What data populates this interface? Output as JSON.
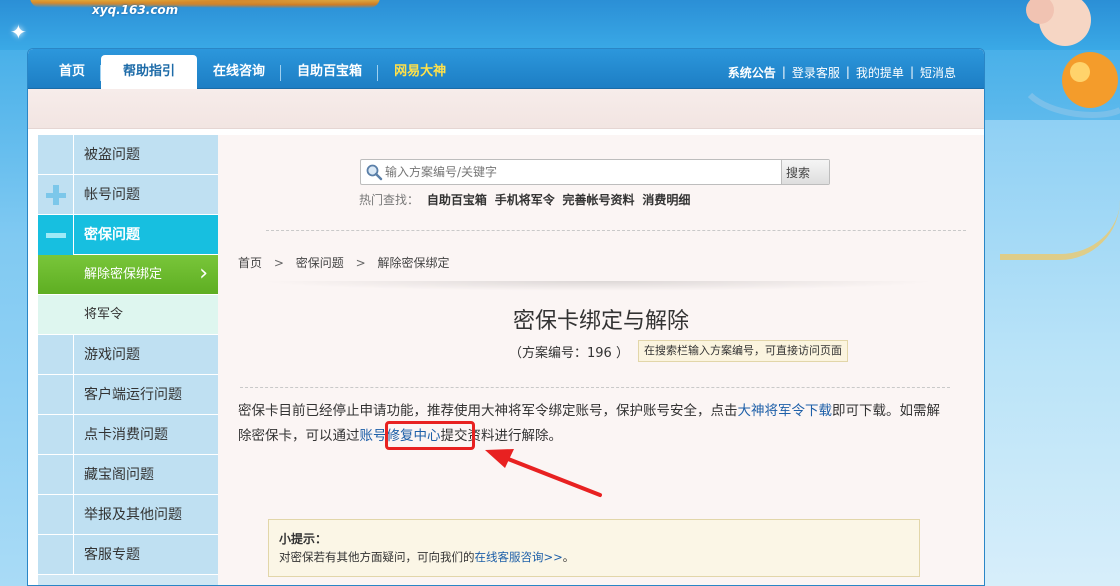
{
  "header": {
    "site": "xyq.163.com"
  },
  "nav": {
    "tabs": [
      {
        "label": "首页"
      },
      {
        "label": "帮助指引",
        "active": true
      },
      {
        "label": "在线咨询"
      },
      {
        "label": "自助百宝箱"
      },
      {
        "label": "网易大神",
        "color": "#ffe14a"
      }
    ],
    "right": [
      "系统公告",
      "登录客服",
      "我的提单",
      "短消息"
    ]
  },
  "sidebar": {
    "items": [
      {
        "label": "被盗问题"
      },
      {
        "label": "帐号问题"
      },
      {
        "label": "密保问题"
      },
      {
        "label": "解除密保绑定"
      },
      {
        "label": "将军令"
      },
      {
        "label": "游戏问题"
      },
      {
        "label": "客户端运行问题"
      },
      {
        "label": "点卡消费问题"
      },
      {
        "label": "藏宝阁问题"
      },
      {
        "label": "举报及其他问题"
      },
      {
        "label": "客服专题"
      }
    ]
  },
  "search": {
    "placeholder": "输入方案编号/关键字",
    "button": "搜索",
    "hot_label": "热门查找：",
    "hot_keywords": [
      "自助百宝箱",
      "手机将军令",
      "完善帐号资料",
      "消费明细"
    ]
  },
  "breadcrumb": [
    "首页",
    "密保问题",
    "解除密保绑定"
  ],
  "article": {
    "title": "密保卡绑定与解除",
    "plan_number": "（方案编号：196 ）",
    "plan_tip": "在搜索栏输入方案编号，可直接访问页面",
    "p1_a": "密保卡目前已经停止申请功能，推荐使用大神将军令绑定账号，保护账号安全，点击",
    "p1_link": "大神将军令下载",
    "p1_b": "即可下载。如需解除密保卡，可以通过",
    "p1_link2": "账号修复中心",
    "p1_c": "提交资料进行解除。"
  },
  "tip": {
    "heading": "小提示：",
    "text_a": "对密保若有其他方面疑问，可向我们的",
    "link": "在线客服咨询>>",
    "text_b": "。"
  },
  "colors": {
    "nav_blue": "#1d7ec4",
    "sidebar_active": "#17bfe0",
    "sidebar_green": "#5eae22",
    "annotation_red": "#e82121"
  }
}
